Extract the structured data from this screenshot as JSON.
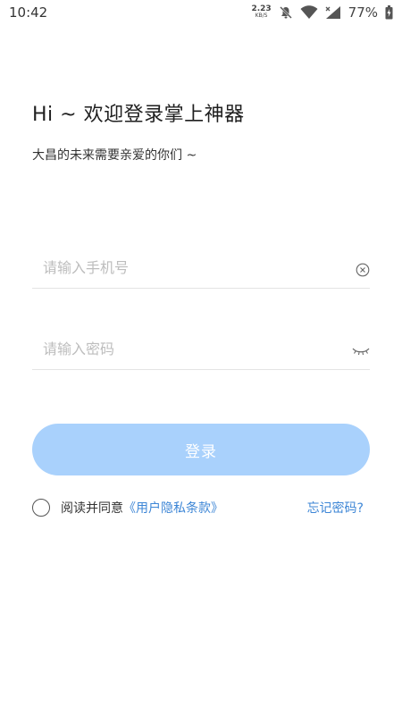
{
  "status_bar": {
    "time": "10:42",
    "net_speed_value": "2.23",
    "net_speed_unit": "KB/S",
    "battery_percent": "77%",
    "icons": [
      "bell-off-icon",
      "wifi-icon",
      "signal-icon",
      "battery-charging-icon"
    ]
  },
  "header": {
    "title": "Hi ~ 欢迎登录掌上神器",
    "subtitle": "大昌的未来需要亲爱的你们 ~"
  },
  "form": {
    "phone": {
      "value": "",
      "placeholder": "请输入手机号",
      "clear_icon": "clear-icon"
    },
    "password": {
      "value": "",
      "placeholder": "请输入密码",
      "visibility_icon": "eye-closed-icon"
    },
    "login_label": "登录"
  },
  "agreement": {
    "checked": false,
    "text": "阅读并同意",
    "terms_link": "《用户隐私条款》",
    "forgot_link": "忘记密码?"
  },
  "colors": {
    "accent": "#3d86d6",
    "button_bg": "#a9d1fc",
    "placeholder": "#bdbdbd",
    "divider": "#e4e4e4"
  }
}
